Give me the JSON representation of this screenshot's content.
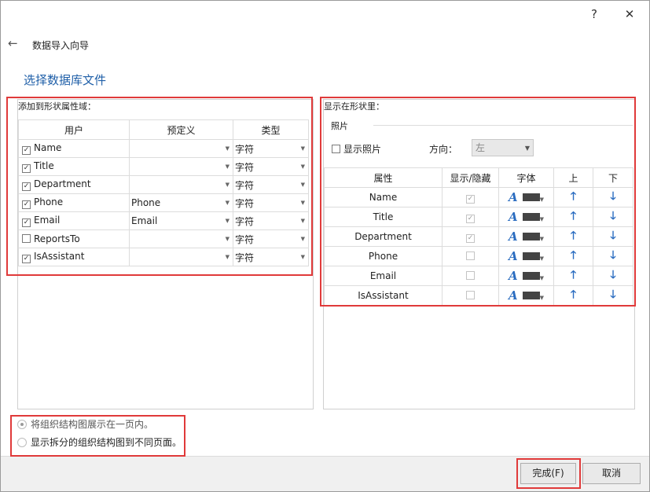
{
  "window": {
    "help": "?",
    "close": "✕"
  },
  "header": {
    "back": "←",
    "wizard_title": "数据导入向导",
    "page_title": "选择数据库文件"
  },
  "left": {
    "label": "添加到形状属性域：",
    "columns": [
      "用户",
      "预定义",
      "类型"
    ],
    "rows": [
      {
        "checked": true,
        "name": "Name",
        "predef": "",
        "type": "字符"
      },
      {
        "checked": true,
        "name": "Title",
        "predef": "",
        "type": "字符"
      },
      {
        "checked": true,
        "name": "Department",
        "predef": "",
        "type": "字符"
      },
      {
        "checked": true,
        "name": "Phone",
        "predef": "Phone",
        "type": "字符"
      },
      {
        "checked": true,
        "name": "Email",
        "predef": "Email",
        "type": "字符"
      },
      {
        "checked": false,
        "name": "ReportsTo",
        "predef": "",
        "type": "字符"
      },
      {
        "checked": true,
        "name": "IsAssistant",
        "predef": "",
        "type": "字符"
      }
    ]
  },
  "right": {
    "label": "显示在形状里：",
    "photo_group": "照片",
    "show_photo": "显示照片",
    "direction_label": "方向：",
    "direction_value": "左",
    "columns": [
      "属性",
      "显示/隐藏",
      "字体",
      "上",
      "下"
    ],
    "font_glyph": "A",
    "up_glyph": "🡑",
    "down_glyph": "🡓",
    "rows": [
      {
        "name": "Name",
        "shown": true
      },
      {
        "name": "Title",
        "shown": true
      },
      {
        "name": "Department",
        "shown": true
      },
      {
        "name": "Phone",
        "shown": false
      },
      {
        "name": "Email",
        "shown": false
      },
      {
        "name": "IsAssistant",
        "shown": false
      }
    ]
  },
  "options": {
    "one_page": "将组织结构图展示在一页内。",
    "split_pages": "显示拆分的组织结构图到不同页面。",
    "selected": "one_page"
  },
  "footer": {
    "finish": "完成(F)",
    "cancel": "取消"
  },
  "colors": {
    "accent": "#1f5fa8",
    "highlight": "#e03a3a",
    "icon_blue": "#2a6cc0"
  }
}
